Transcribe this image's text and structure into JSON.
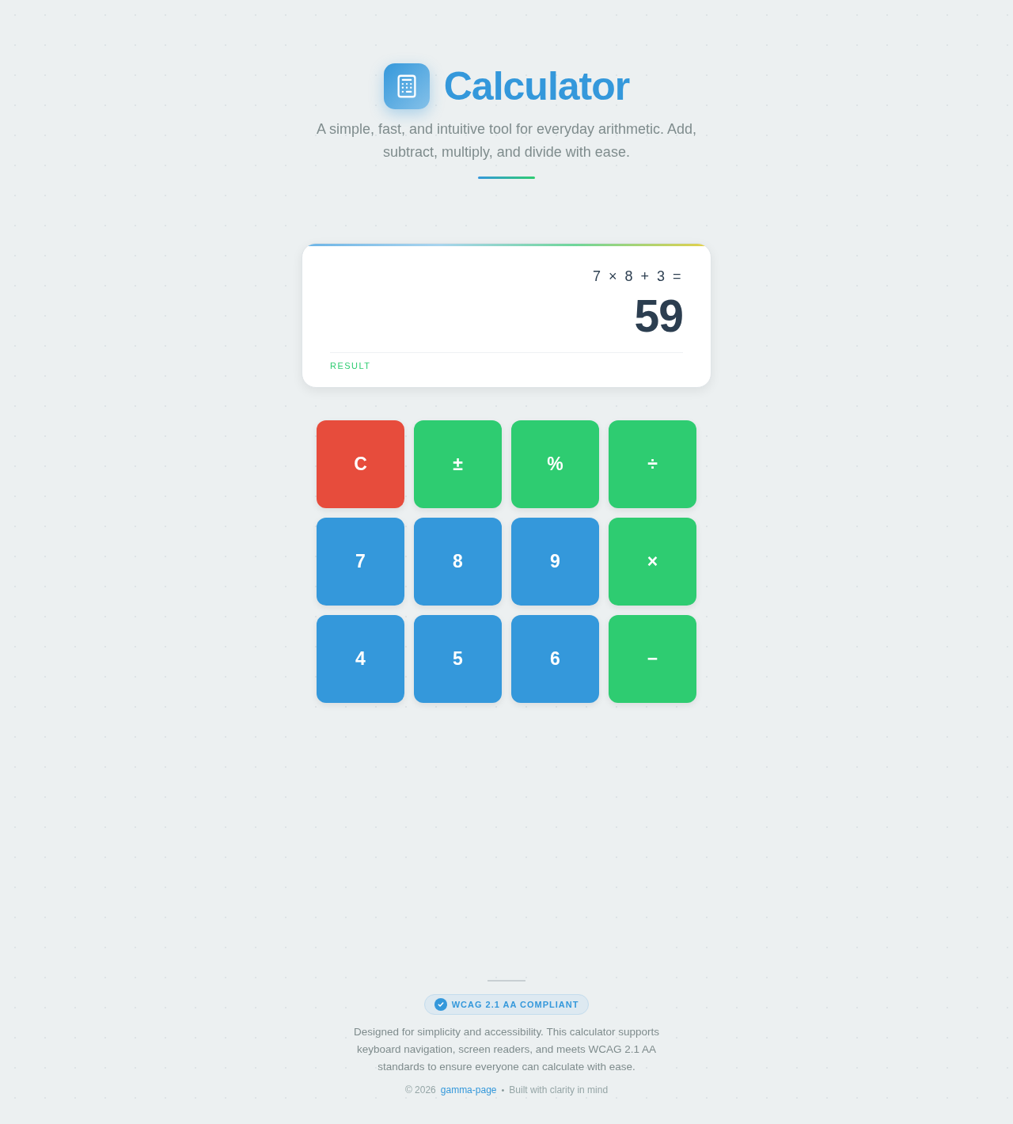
{
  "header": {
    "title": "Calculator",
    "subtitle": "A simple, fast, and intuitive tool for everyday arithmetic. Add, subtract, multiply, and divide with ease."
  },
  "display": {
    "expression": "7 × 8 + 3 =",
    "result": "59",
    "label": "RESULT"
  },
  "keypad": [
    {
      "label": "C",
      "kind": "clear"
    },
    {
      "label": "±",
      "kind": "operator"
    },
    {
      "label": "%",
      "kind": "operator"
    },
    {
      "label": "÷",
      "kind": "operator"
    },
    {
      "label": "7",
      "kind": "digit"
    },
    {
      "label": "8",
      "kind": "digit"
    },
    {
      "label": "9",
      "kind": "digit"
    },
    {
      "label": "×",
      "kind": "operator"
    },
    {
      "label": "4",
      "kind": "digit"
    },
    {
      "label": "5",
      "kind": "digit"
    },
    {
      "label": "6",
      "kind": "digit"
    },
    {
      "label": "−",
      "kind": "operator"
    }
  ],
  "footer": {
    "badge": "WCAG 2.1 AA COMPLIANT",
    "description": "Designed for simplicity and accessibility. This calculator supports keyboard navigation, screen readers, and meets WCAG 2.1 AA standards to ensure everyone can calculate with ease.",
    "copyright": "© 2026",
    "link": "gamma-page",
    "separator": "•",
    "tagline": "Built with clarity in mind"
  }
}
